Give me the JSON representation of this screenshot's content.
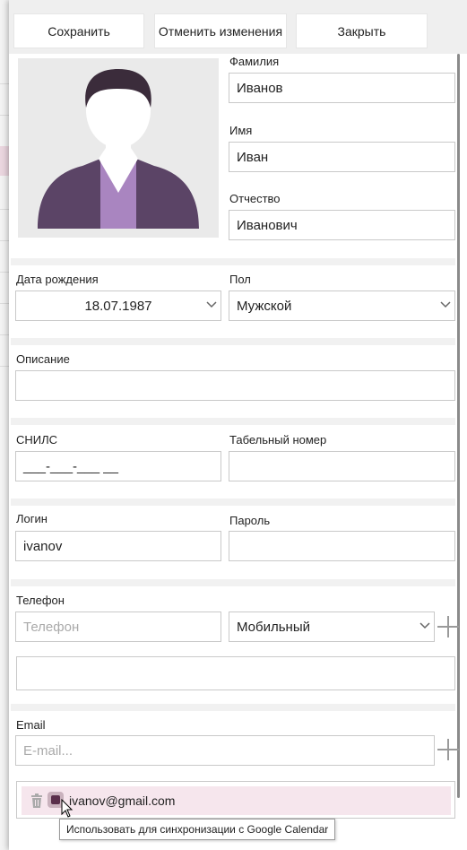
{
  "toolbar": {
    "save": "Сохранить",
    "cancel": "Отменить изменения",
    "close": "Закрыть"
  },
  "name": {
    "last_label": "Фамилия",
    "last_value": "Иванов",
    "first_label": "Имя",
    "first_value": "Иван",
    "middle_label": "Отчество",
    "middle_value": "Иванович"
  },
  "birth": {
    "label": "Дата рождения",
    "value": "18.07.1987"
  },
  "gender": {
    "label": "Пол",
    "value": "Мужской"
  },
  "description": {
    "label": "Описание",
    "value": ""
  },
  "snils": {
    "label": "СНИЛС",
    "value": "___-___-___ __"
  },
  "tab_number": {
    "label": "Табельный номер",
    "value": ""
  },
  "login": {
    "label": "Логин",
    "value": "ivanov"
  },
  "password": {
    "label": "Пароль",
    "value": ""
  },
  "phone": {
    "label": "Телефон",
    "placeholder": "Телефон",
    "type_value": "Мобильный"
  },
  "email": {
    "label": "Email",
    "placeholder": "E-mail...",
    "items": [
      {
        "address": "ivanov@gmail.com"
      }
    ],
    "tooltip": "Использовать для синхронизации с Google Calendar"
  },
  "colors": {
    "accent": "#5a2f4b",
    "avatar_body": "#5b4466",
    "avatar_tie": "#a985c0",
    "item_bg": "#f6e6ed"
  }
}
